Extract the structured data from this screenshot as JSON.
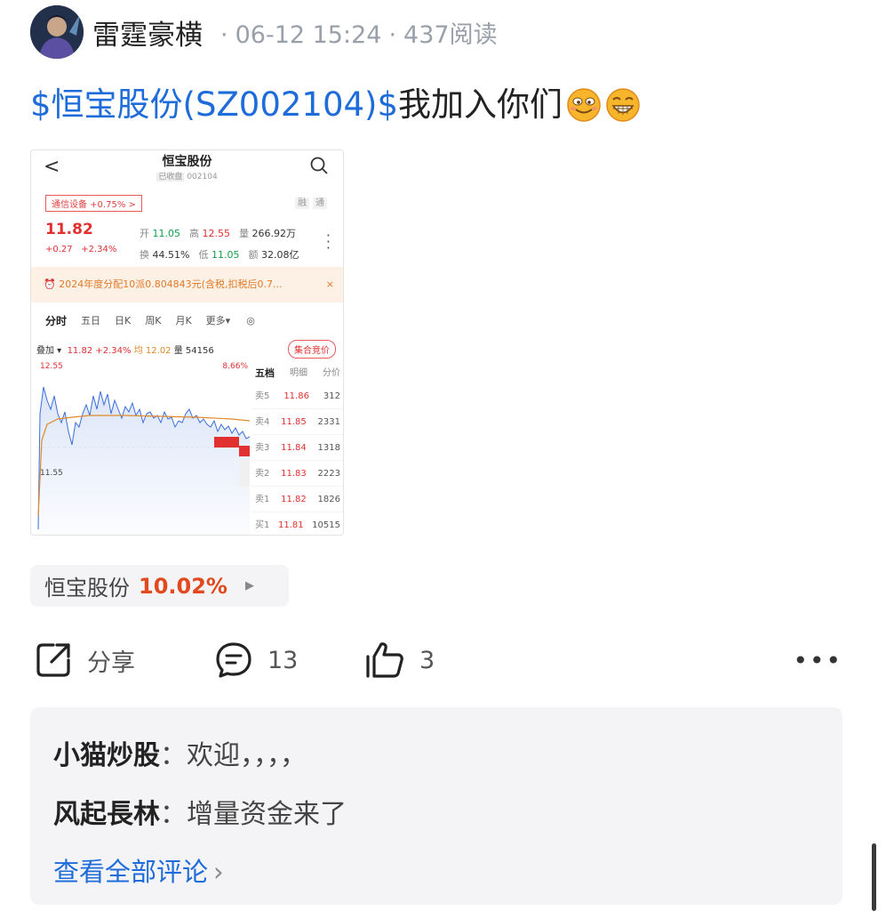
{
  "post": {
    "author": "雷霆豪横",
    "date": "06-12 15:24",
    "reads": "437阅读",
    "stock_link": "$恒宝股份(SZ002104)$",
    "text": "我加入你们"
  },
  "screenshot": {
    "back": "<",
    "name": "恒宝股份",
    "status_tag": "已收盘",
    "code": "002104",
    "sector": "通信设备 +0.75% >",
    "rong": "融",
    "tong": "通",
    "price": "11.82",
    "change": "+0.27",
    "change_pct": "+2.34%",
    "quote": {
      "open_label": "开",
      "open": "11.05",
      "high_label": "高",
      "high": "12.55",
      "vol_label": "量",
      "vol": "266.92万",
      "turn_label": "换",
      "turn": "44.51%",
      "low_label": "低",
      "low": "11.05",
      "amt_label": "额",
      "amt": "32.08亿"
    },
    "notice": "2024年度分配10派0.804843元(含税,扣税后0.7...",
    "notice_close": "×",
    "periods": [
      "分时",
      "五日",
      "日K",
      "周K",
      "月K",
      "更多▾"
    ],
    "overlay": {
      "label": "叠加 ▾",
      "price": "11.82",
      "pct": "+2.34%",
      "avg": "均 12.02",
      "vol": "量 54156"
    },
    "auction": "集合竞价",
    "chart": {
      "hi": "12.55",
      "pct": "8.66%",
      "lo": "11.55"
    },
    "book_tabs": [
      "五档",
      "明细",
      "分价"
    ],
    "book": [
      {
        "label": "卖5",
        "price": "11.86",
        "qty": "312"
      },
      {
        "label": "卖4",
        "price": "11.85",
        "qty": "2331"
      },
      {
        "label": "卖3",
        "price": "11.84",
        "qty": "1318"
      },
      {
        "label": "卖2",
        "price": "11.83",
        "qty": "2223"
      },
      {
        "label": "卖1",
        "price": "11.82",
        "qty": "1826"
      },
      {
        "label": "买1",
        "price": "11.81",
        "qty": "10515"
      }
    ]
  },
  "chip": {
    "name": "恒宝股份",
    "pct": "10.02%",
    "arrow": "▶"
  },
  "actions": {
    "share": "分享",
    "comments": "13",
    "likes": "3",
    "more": "•••"
  },
  "comments": [
    {
      "user": "小猫炒股",
      "colon": "：",
      "text": "欢迎，，，，"
    },
    {
      "user": "风起長林",
      "colon": "：",
      "text": "增量资金来了"
    }
  ],
  "all_comments": "查看全部评论",
  "colors": {
    "link": "#1e6cd9",
    "up": "#e03030",
    "chip_pct": "#e04a1e"
  }
}
